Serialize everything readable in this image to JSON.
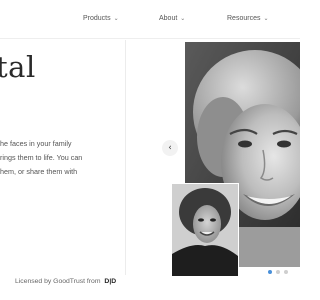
{
  "nav": {
    "items": [
      {
        "label": "Products"
      },
      {
        "label": "About"
      },
      {
        "label": "Resources"
      }
    ]
  },
  "hero": {
    "title": "tal",
    "body_lines": [
      "he faces in your family",
      "rings them to life. You can",
      "hem, or share them with"
    ]
  },
  "footer": {
    "license_text": "Licensed by GoodTrust from",
    "license_logo": "D|D"
  },
  "carousel": {
    "prev_icon": "chevron-left-icon",
    "prev_glyph": "‹",
    "active_index": 0,
    "slide_count": 3
  },
  "colors": {
    "accent": "#4a90d9",
    "text": "#333333"
  }
}
